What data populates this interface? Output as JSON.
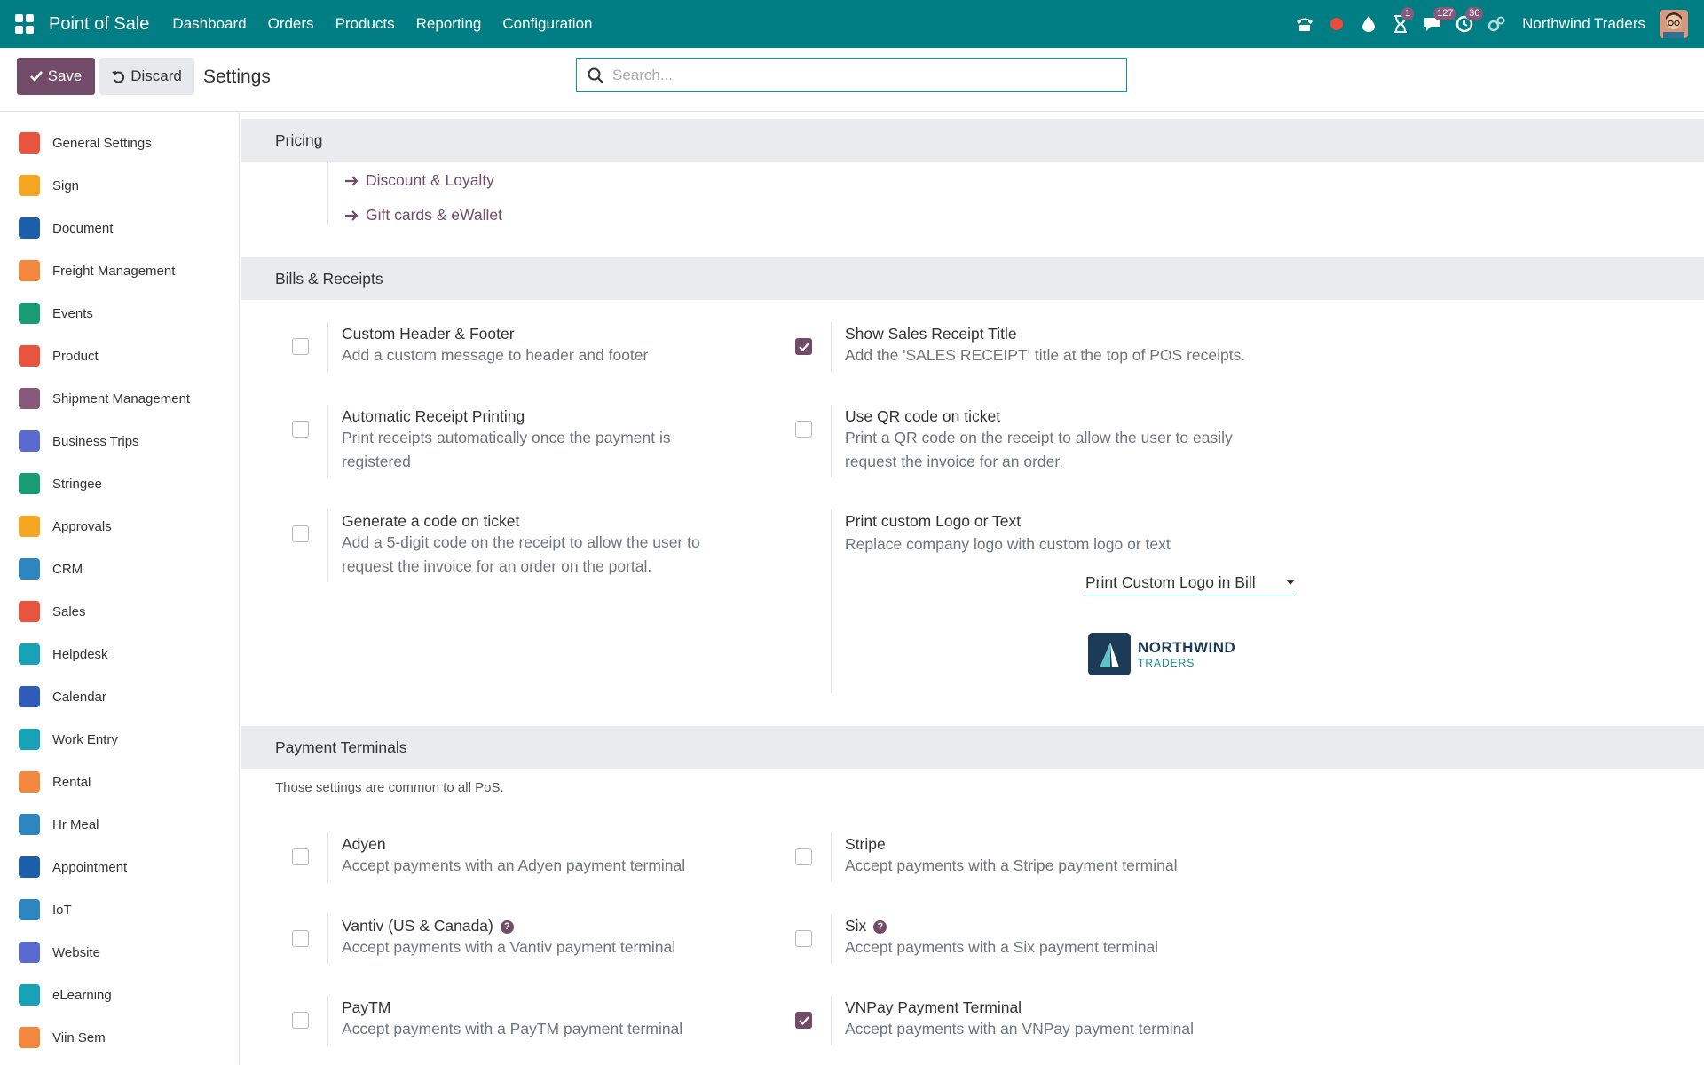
{
  "navbar": {
    "brand": "Point of Sale",
    "menu": [
      "Dashboard",
      "Orders",
      "Products",
      "Reporting",
      "Configuration"
    ],
    "badges": {
      "activity": "1",
      "messages": "127",
      "timer": "36"
    },
    "company": "Northwind Traders",
    "color": "#017e84"
  },
  "control": {
    "save_label": "Save",
    "discard_label": "Discard",
    "title": "Settings",
    "search_placeholder": "Search..."
  },
  "sidebar": {
    "items": [
      {
        "label": "General Settings",
        "icon": "settings-icon",
        "color": "#e8543f"
      },
      {
        "label": "Sign",
        "icon": "sign-icon",
        "color": "#f5a623"
      },
      {
        "label": "Document",
        "icon": "folder-icon",
        "color": "#1c5ea8"
      },
      {
        "label": "Freight Management",
        "icon": "freight-icon",
        "color": "#f0883e"
      },
      {
        "label": "Events",
        "icon": "events-icon",
        "color": "#1a9d74"
      },
      {
        "label": "Product",
        "icon": "product-icon",
        "color": "#e8543f"
      },
      {
        "label": "Shipment Management",
        "icon": "shipment-icon",
        "color": "#875a7b"
      },
      {
        "label": "Business Trips",
        "icon": "business-trips-icon",
        "color": "#5b6ad0"
      },
      {
        "label": "Stringee",
        "icon": "stringee-icon",
        "color": "#1a9d74"
      },
      {
        "label": "Approvals",
        "icon": "approvals-icon",
        "color": "#f5a623"
      },
      {
        "label": "CRM",
        "icon": "crm-icon",
        "color": "#2e86c1"
      },
      {
        "label": "Sales",
        "icon": "sales-icon",
        "color": "#e8543f"
      },
      {
        "label": "Helpdesk",
        "icon": "helpdesk-icon",
        "color": "#17a2b8"
      },
      {
        "label": "Calendar",
        "icon": "calendar-icon",
        "color": "#2e5cb8"
      },
      {
        "label": "Work Entry",
        "icon": "work-entry-icon",
        "color": "#17a2b8"
      },
      {
        "label": "Rental",
        "icon": "rental-icon",
        "color": "#f0883e"
      },
      {
        "label": "Hr Meal",
        "icon": "meal-icon",
        "color": "#2e86c1"
      },
      {
        "label": "Appointment",
        "icon": "appointment-icon",
        "color": "#1c5ea8"
      },
      {
        "label": "IoT",
        "icon": "iot-icon",
        "color": "#2e86c1"
      },
      {
        "label": "Website",
        "icon": "website-icon",
        "color": "#5b6ad0"
      },
      {
        "label": "eLearning",
        "icon": "elearning-icon",
        "color": "#17a2b8"
      },
      {
        "label": "Viin Sem",
        "icon": "viin-sem-icon",
        "color": "#f0883e"
      }
    ]
  },
  "pricing": {
    "heading": "Pricing",
    "links": [
      "Discount & Loyalty",
      "Gift cards & eWallet"
    ]
  },
  "bills": {
    "heading": "Bills & Receipts",
    "options": [
      {
        "title": "Custom Header & Footer",
        "desc": "Add a custom message to header and footer",
        "checked": false
      },
      {
        "title": "Show Sales Receipt Title",
        "desc": "Add the 'SALES RECEIPT' title at the top of POS receipts.",
        "checked": true
      },
      {
        "title": "Automatic Receipt Printing",
        "desc": "Print receipts automatically once the payment is registered",
        "checked": false
      },
      {
        "title": "Use QR code on ticket",
        "desc": "Print a QR code on the receipt to allow the user to easily request the invoice for an order.",
        "checked": false
      },
      {
        "title": "Generate a code on ticket",
        "desc": "Add a 5-digit code on the receipt to allow the user to request the invoice for an order on the portal.",
        "checked": false
      },
      {
        "title": "Print custom Logo or Text",
        "desc": "Replace company logo with custom logo or text"
      }
    ],
    "logo_select": "Print Custom Logo in Bill",
    "logo": {
      "name": "NORTHWIND",
      "sub": "TRADERS"
    }
  },
  "terminals": {
    "heading": "Payment Terminals",
    "note": "Those settings are common to all PoS.",
    "options": [
      {
        "title": "Adyen",
        "desc": "Accept payments with an Adyen payment terminal",
        "checked": false
      },
      {
        "title": "Stripe",
        "desc": "Accept payments with a Stripe payment terminal",
        "checked": false
      },
      {
        "title": "Vantiv (US & Canada)",
        "desc": "Accept payments with a Vantiv payment terminal",
        "checked": false
      },
      {
        "title": "Six",
        "desc": "Accept payments with a Six payment terminal",
        "checked": false
      },
      {
        "title": "PayTM",
        "desc": "Accept payments with a PayTM payment terminal",
        "checked": false
      },
      {
        "title": "VNPay Payment Terminal",
        "desc": "Accept payments with an VNPay payment terminal",
        "checked": true
      }
    ]
  }
}
